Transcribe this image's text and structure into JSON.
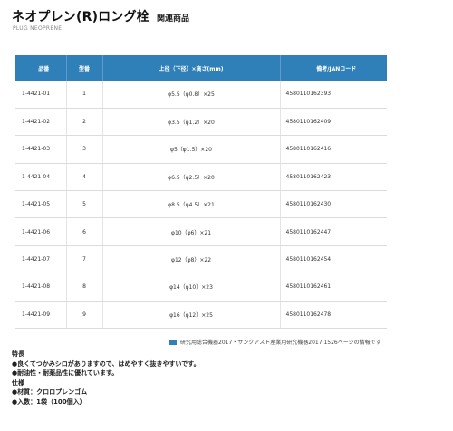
{
  "header": {
    "title": "ネオプレン(R)ロング栓",
    "tag": "関連商品",
    "subtitle": "PLUG NEOPRENE"
  },
  "table": {
    "columns": [
      "品番",
      "型番",
      "上径（下径）×高さ(mm)",
      "備考/JANコード"
    ],
    "rows": [
      {
        "code": "1-4421-01",
        "num": "1",
        "size": "φ5.5（φ0.8）×25",
        "jan": "4580110162393"
      },
      {
        "code": "1-4421-02",
        "num": "2",
        "size": "φ3.5（φ1.2）×20",
        "jan": "4580110162409"
      },
      {
        "code": "1-4421-03",
        "num": "3",
        "size": "φ5（φ1.5）×20",
        "jan": "4580110162416"
      },
      {
        "code": "1-4421-04",
        "num": "4",
        "size": "φ6.5（φ2.5）×20",
        "jan": "4580110162423"
      },
      {
        "code": "1-4421-05",
        "num": "5",
        "size": "φ8.5（φ4.5）×21",
        "jan": "4580110162430"
      },
      {
        "code": "1-4421-06",
        "num": "6",
        "size": "φ10（φ6）×21",
        "jan": "4580110162447"
      },
      {
        "code": "1-4421-07",
        "num": "7",
        "size": "φ12（φ8）×22",
        "jan": "4580110162454"
      },
      {
        "code": "1-4421-08",
        "num": "8",
        "size": "φ14（φ10）×23",
        "jan": "4580110162461"
      },
      {
        "code": "1-4421-09",
        "num": "9",
        "size": "φ16（φ12）×25",
        "jan": "4580110162478"
      }
    ]
  },
  "note": "研究用総合機器2017・サンクアスト産業用研究機器2017 1526ページの情報です",
  "features": [
    "特長",
    "●良くてつかみシロがありますので、はめやすく抜きやすいです。",
    "●耐油性・耐薬品性に優れています。",
    "仕様",
    "●材質：クロロプレンゴム",
    "●入数：1袋（100個入）"
  ],
  "colors": {
    "header_blue": "#2f7fb8"
  }
}
